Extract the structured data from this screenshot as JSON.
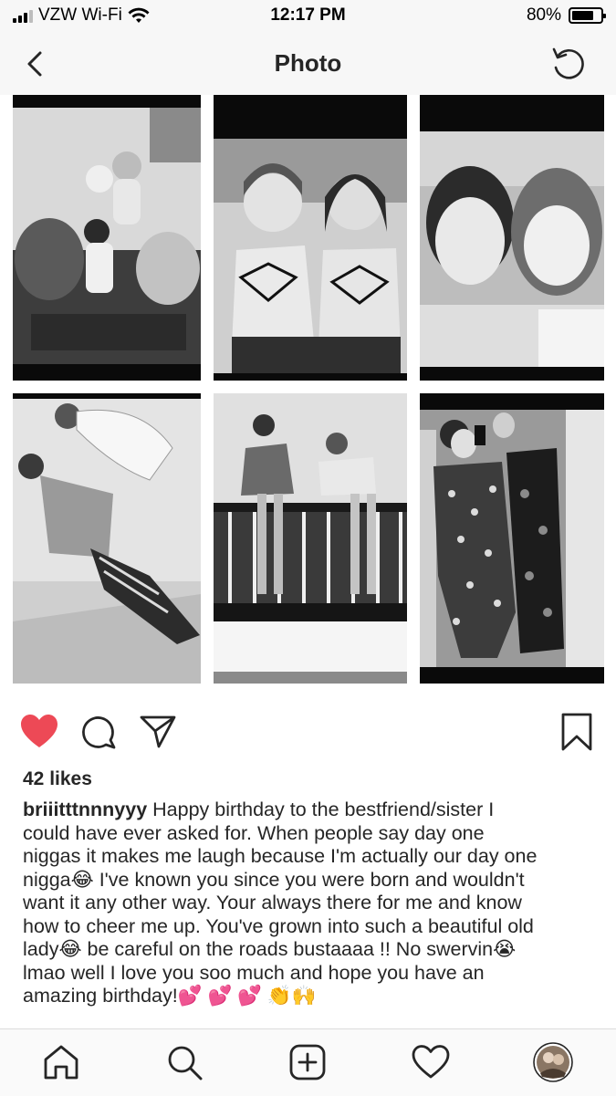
{
  "status_bar": {
    "carrier": "VZW Wi-Fi",
    "time": "12:17 PM",
    "battery": "80%",
    "battery_level": 0.8,
    "icons": [
      "signal-icon",
      "wifi-icon",
      "battery-icon"
    ]
  },
  "nav": {
    "title": "Photo",
    "icons": [
      "back-chevron-icon",
      "refresh-icon"
    ]
  },
  "photo": {
    "description_icons": [
      "collage-photo-icon"
    ],
    "tiles": 6
  },
  "actions": {
    "liked": true,
    "like_color": "#ed4956",
    "icons": [
      "heart-icon",
      "comment-icon",
      "share-icon",
      "bookmark-icon"
    ]
  },
  "post": {
    "likes": "42 likes",
    "username": "briiitttnnnyyy",
    "caption_lines": [
      " Happy birthday to the bestfriend/sister I",
      "could have ever asked for. When people say day one",
      "niggas it makes me laugh because I'm actually our day one",
      "nigga😂 I've known you since you were born and wouldn't",
      "want it any other way. Your always there for me and know",
      "how to cheer me up. You've grown into such a beautiful old",
      "lady😂 be careful on the roads bustaaaa !! No swervin😭",
      "lmao well I love you soo much and hope you have an",
      "amazing birthday!💕 💕 💕 👏🙌"
    ]
  },
  "tab_bar": {
    "icons": [
      "home-icon",
      "search-icon",
      "add-post-icon",
      "activity-heart-icon",
      "profile-avatar-icon"
    ]
  }
}
